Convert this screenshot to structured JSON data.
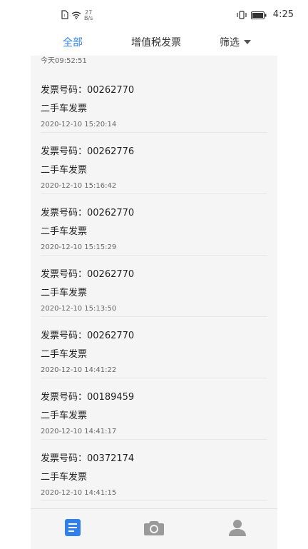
{
  "status_bar": {
    "speed_value": "27",
    "speed_unit": "B/s",
    "time": "4:25",
    "icons": [
      "sim-icon",
      "wifi-icon",
      "vibrate-icon",
      "battery-icon"
    ]
  },
  "tabs": {
    "all": "全部",
    "vat": "增值税发票",
    "filter": "筛选"
  },
  "list": {
    "partial_top_time": "今天09:52:51",
    "items": [
      {
        "number": "发票号码：00262770",
        "type": "二手车发票",
        "time": "2020-12-10 15:20:14"
      },
      {
        "number": "发票号码：00262776",
        "type": "二手车发票",
        "time": "2020-12-10 15:16:42"
      },
      {
        "number": "发票号码：00262770",
        "type": "二手车发票",
        "time": "2020-12-10 15:15:29"
      },
      {
        "number": "发票号码：00262770",
        "type": "二手车发票",
        "time": "2020-12-10 15:13:50"
      },
      {
        "number": "发票号码：00262770",
        "type": "二手车发票",
        "time": "2020-12-10 14:41:22"
      },
      {
        "number": "发票号码：00189459",
        "type": "二手车发票",
        "time": "2020-12-10 14:41:17"
      },
      {
        "number": "发票号码：00372174",
        "type": "二手车发票",
        "time": "2020-12-10 14:41:15"
      }
    ]
  },
  "bottom_nav": {
    "icons": [
      "list-icon",
      "camera-icon",
      "user-icon"
    ],
    "active": "list-icon"
  },
  "colors": {
    "accent": "#2f80ed",
    "list_background": "#f5f5f5",
    "inactive_icon": "#9a9a9a"
  }
}
